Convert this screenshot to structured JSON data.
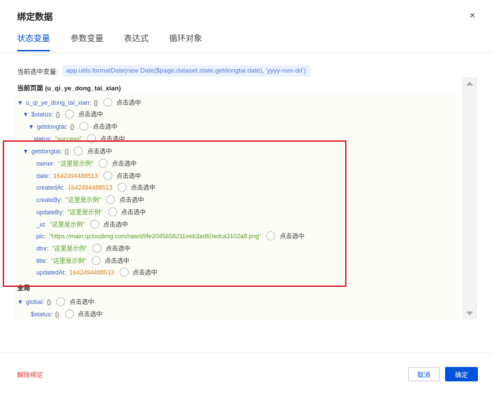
{
  "dialog": {
    "title": "绑定数据",
    "close": "×"
  },
  "tabs": [
    {
      "label": "状态变量"
    },
    {
      "label": "参数变量"
    },
    {
      "label": "表达式"
    },
    {
      "label": "循环对象"
    }
  ],
  "selection": {
    "label": "当前选中变量:",
    "value": "app.utils.formatDate(new Date($page.dataset.state.getdongtai.date), 'yyyy-mm-dd')"
  },
  "sections": {
    "current_page": "当前页面 (u_qi_ye_dong_tai_xian)",
    "global": "全局"
  },
  "click_select": "点击选中",
  "tree": {
    "page": {
      "key": "u_qi_ye_dong_tai_xian:",
      "brace": "{}"
    },
    "status": {
      "key": "$status:",
      "brace": "{}"
    },
    "status_getdongtai": {
      "key": "getdongtai:",
      "brace": "{}"
    },
    "status_status": {
      "key": "status:",
      "value": "\"success\""
    },
    "getdongtai": {
      "key": "getdongtai:",
      "brace": "{}"
    },
    "fields": [
      {
        "key": "owner:",
        "value": "\"这里是示例\"",
        "type": "str"
      },
      {
        "key": "date:",
        "value": "1642494488513",
        "type": "num"
      },
      {
        "key": "createdAt:",
        "value": "1642494488513",
        "type": "num"
      },
      {
        "key": "createBy:",
        "value": "\"这里是示例\"",
        "type": "str"
      },
      {
        "key": "updateBy:",
        "value": "\"这里是示例\"",
        "type": "str"
      },
      {
        "key": "_id:",
        "value": "\"这里是示例\"",
        "type": "str"
      },
      {
        "key": "pic:",
        "value": "\"https://main.qcloudimg.com/raw/d9fe2045658211eeb3ad60edca3102a8.png\"",
        "type": "str"
      },
      {
        "key": "dtnr:",
        "value": "\"这里是示例\"",
        "type": "str"
      },
      {
        "key": "title:",
        "value": "\"这里是示例\"",
        "type": "str"
      },
      {
        "key": "updatedAt:",
        "value": "1642494488513",
        "type": "num"
      }
    ],
    "global": {
      "key": "global:",
      "brace": "{}"
    },
    "global_status": {
      "key": "$status:",
      "brace": "{}"
    }
  },
  "footer": {
    "unbind": "解除绑定",
    "cancel": "取消",
    "ok": "确定"
  },
  "colors": {
    "accent": "#0052d9",
    "highlight_box": "#e0202a",
    "string": "#5aa02c",
    "number": "#e07c1a"
  }
}
